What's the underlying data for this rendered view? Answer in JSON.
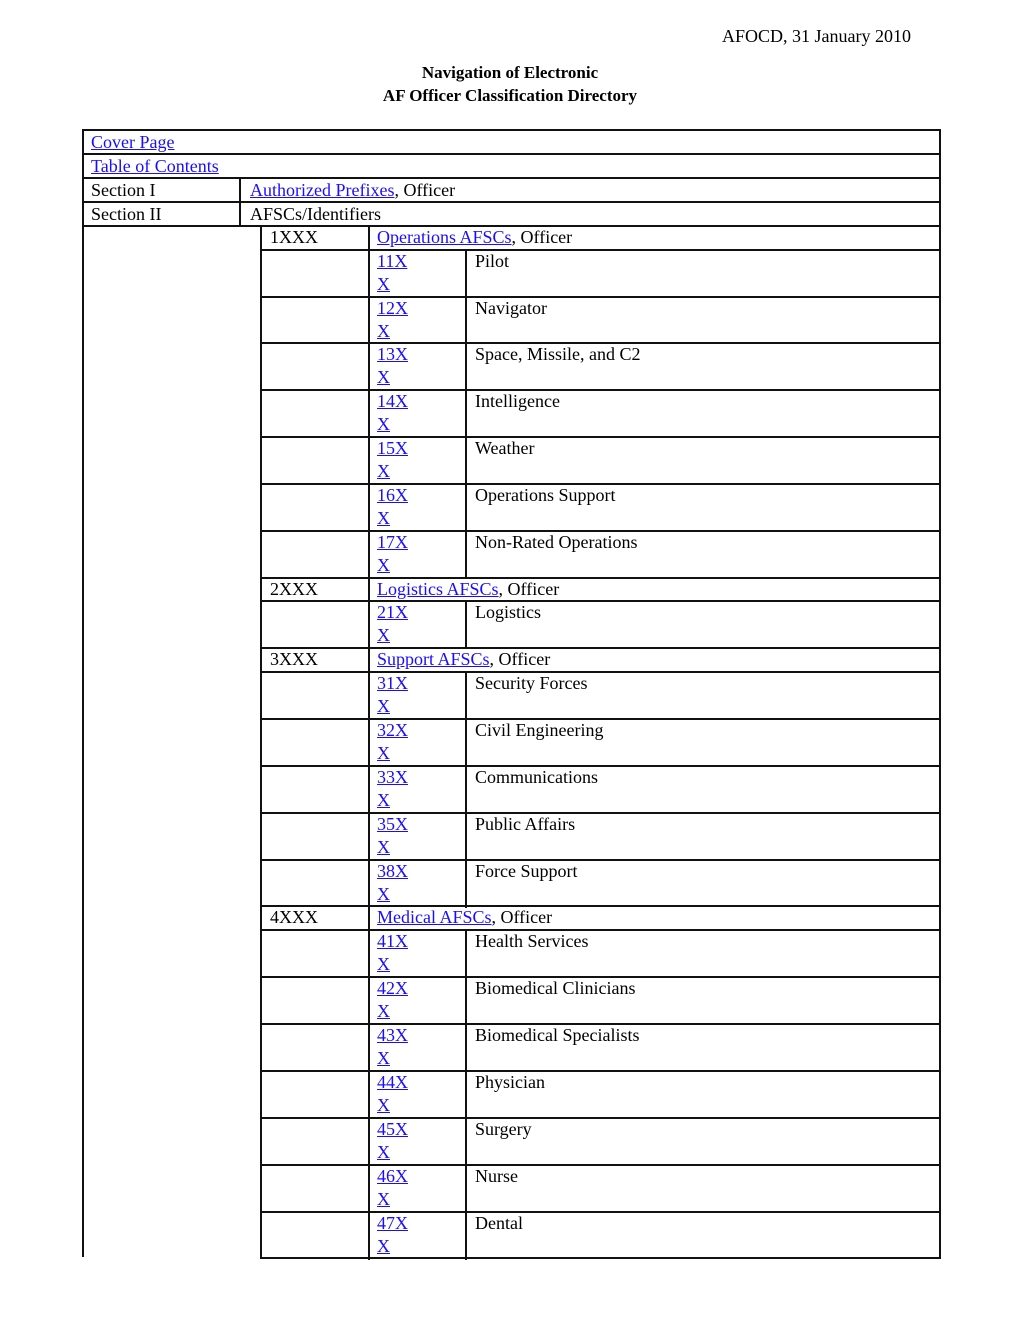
{
  "header": {
    "date": "AFOCD, 31 January 2010"
  },
  "title": {
    "line1": "Navigation of Electronic",
    "line2": "AF Officer Classification Directory"
  },
  "colors": {
    "link": "#1a0dff",
    "text": "#000000",
    "border": "#111111"
  },
  "rows": {
    "cover_page": "Cover Page",
    "table_of_contents": "Table of Contents",
    "section1": {
      "label": "Section I",
      "link": "Authorized Prefixes",
      "suffix": ", Officer"
    },
    "section2": {
      "label": "Section II",
      "text": "AFSCs/Identifiers"
    }
  },
  "groups": [
    {
      "code": "1XXX",
      "link": "Operations AFSCs",
      "suffix": ", Officer",
      "items": [
        {
          "code": "11X",
          "code2": "X",
          "title": "Pilot"
        },
        {
          "code": "12X",
          "code2": "X",
          "title": "Navigator"
        },
        {
          "code": "13X",
          "code2": "X",
          "title": "Space, Missile, and C2"
        },
        {
          "code": "14X",
          "code2": "X",
          "title": "Intelligence"
        },
        {
          "code": "15X",
          "code2": "X",
          "title": "Weather"
        },
        {
          "code": "16X",
          "code2": "X",
          "title": "Operations Support"
        },
        {
          "code": "17X",
          "code2": "X",
          "title": "Non-Rated Operations"
        }
      ]
    },
    {
      "code": "2XXX",
      "link": "Logistics AFSCs",
      "suffix": ", Officer",
      "items": [
        {
          "code": "21X",
          "code2": "X",
          "title": "Logistics"
        }
      ]
    },
    {
      "code": "3XXX",
      "link": "Support AFSCs",
      "suffix": ", Officer",
      "items": [
        {
          "code": "31X",
          "code2": "X",
          "title": "Security Forces"
        },
        {
          "code": "32X",
          "code2": "X",
          "title": "Civil Engineering"
        },
        {
          "code": "33X",
          "code2": "X",
          "title": "Communications"
        },
        {
          "code": "35X",
          "code2": "X",
          "title": "Public Affairs"
        },
        {
          "code": "38X",
          "code2": "X",
          "title": "Force Support"
        }
      ]
    },
    {
      "code": "4XXX",
      "link": "Medical AFSCs",
      "suffix": ", Officer",
      "items": [
        {
          "code": "41X",
          "code2": "X",
          "title": "Health Services"
        },
        {
          "code": "42X",
          "code2": "X",
          "title": "Biomedical Clinicians"
        },
        {
          "code": "43X",
          "code2": "X",
          "title": "Biomedical Specialists"
        },
        {
          "code": "44X",
          "code2": "X",
          "title": "Physician"
        },
        {
          "code": "45X",
          "code2": "X",
          "title": "Surgery"
        },
        {
          "code": "46X",
          "code2": "X",
          "title": "Nurse"
        },
        {
          "code": "47X",
          "code2": "X",
          "title": "Dental"
        }
      ]
    }
  ]
}
